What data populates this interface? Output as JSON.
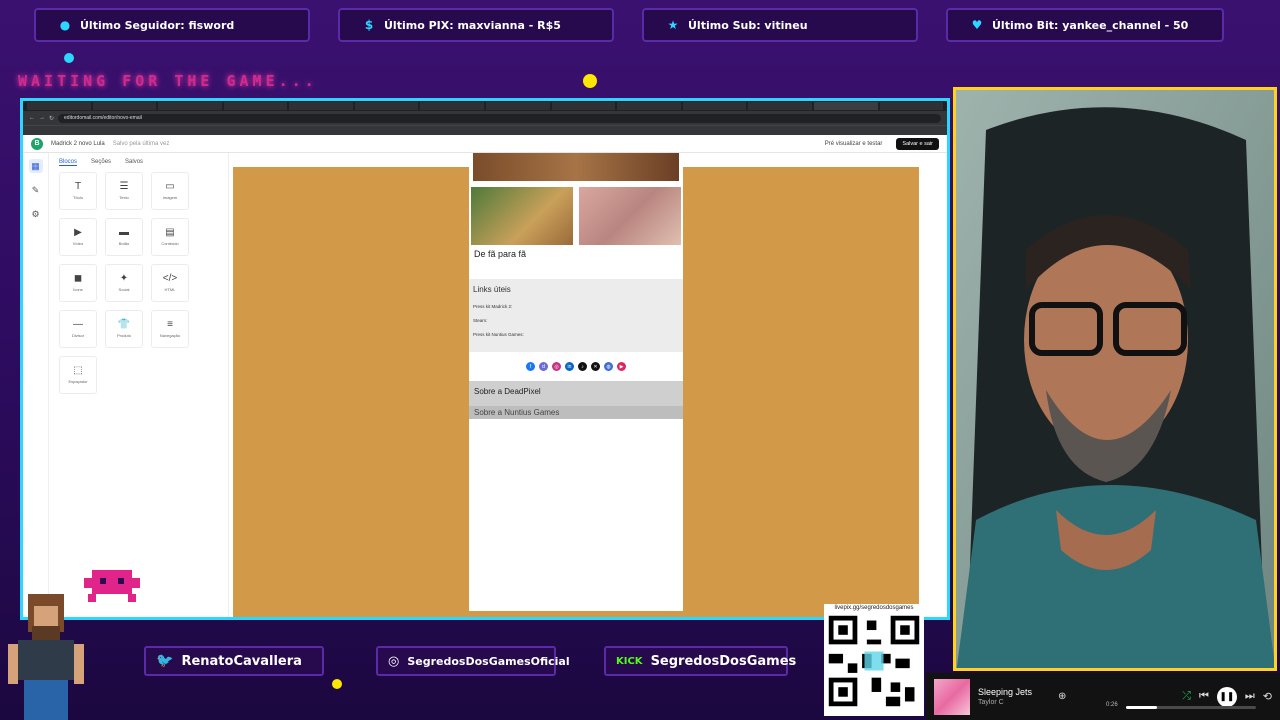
{
  "ticker": {
    "follower": "Último Seguidor: fisword",
    "pix": "Último PIX: maxvianna - R$5",
    "sub": "Último Sub: vitineu",
    "bit": "Último Bit: yankee_channel - 50"
  },
  "waiting_text": "WAITING FOR THE GAME...",
  "browser": {
    "url": "editordomail.com/editor/novo-email",
    "editor": {
      "doc_title": "Madrick 2 novo Lula",
      "status": "Salvo pela última vez",
      "preview_label": "Pré visualizar e testar",
      "save_label": "Salvar e sair",
      "panel_tabs": [
        "Blocos",
        "Seções",
        "Salvos"
      ],
      "blocks": [
        {
          "label": "Título",
          "icon": "T"
        },
        {
          "label": "Texto",
          "icon": "☰"
        },
        {
          "label": "Imagem",
          "icon": "▭"
        },
        {
          "label": "Vídeo",
          "icon": "▶"
        },
        {
          "label": "Botão",
          "icon": "▬"
        },
        {
          "label": "Conteúdo",
          "icon": "▤"
        },
        {
          "label": "Ícone",
          "icon": "◼"
        },
        {
          "label": "Social",
          "icon": "✦"
        },
        {
          "label": "HTML",
          "icon": "</>"
        },
        {
          "label": "Divisor",
          "icon": "—"
        },
        {
          "label": "Produto",
          "icon": "👕"
        },
        {
          "label": "Navegação",
          "icon": "≡"
        },
        {
          "label": "Espaçador",
          "icon": "⬚"
        }
      ],
      "email": {
        "section_title": "De fã para fã",
        "links_title": "Links úteis",
        "link1_label": "Press kit Madrick 2:",
        "link2_label": "Steam:",
        "link3_label": "Press kit Nuntius Games:",
        "about_title": "Sobre a DeadPixel",
        "footer_title": "Sobre a Nuntius Games"
      }
    }
  },
  "social": {
    "twitter": "RenatoCavallera",
    "instagram": "SegredosDosGamesOficial",
    "kick_badge": "KICK",
    "kick": "SegredosDosGames"
  },
  "qr_label": "livepix.gg/segredosdosgames",
  "player": {
    "title": "Sleeping Jets",
    "artist": "Taylor C",
    "time": "0:26",
    "progress": 0.24
  }
}
